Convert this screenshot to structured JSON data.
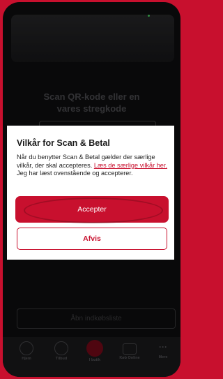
{
  "scanner": {
    "instruction_line1": "Scan QR-kode eller en",
    "instruction_line2": "vares stregkode"
  },
  "dialog": {
    "title": "Vilkår for Scan & Betal",
    "body_prefix": "Når du benytter Scan & Betal gælder der særlige vilkår, der skal accepteres.",
    "link_text": "Læs de særlige vilkår her.",
    "body_suffix": "Jeg har læst ovenstående og accepterer.",
    "accept_label": "Accepter",
    "decline_label": "Afvis"
  },
  "shopping_list_button": "Åbn indkøbsliste",
  "bottom_nav": {
    "items": [
      {
        "label": "Hjem",
        "icon": "home-icon"
      },
      {
        "label": "Tilbud",
        "icon": "percent-icon"
      },
      {
        "label": "I butik",
        "icon": "store-icon"
      },
      {
        "label": "Køb Online",
        "icon": "truck-icon"
      },
      {
        "label": "Mere",
        "icon": "more-icon"
      }
    ]
  },
  "colors": {
    "brand_red": "#c8102e",
    "frame_background": "#0f0f10"
  }
}
